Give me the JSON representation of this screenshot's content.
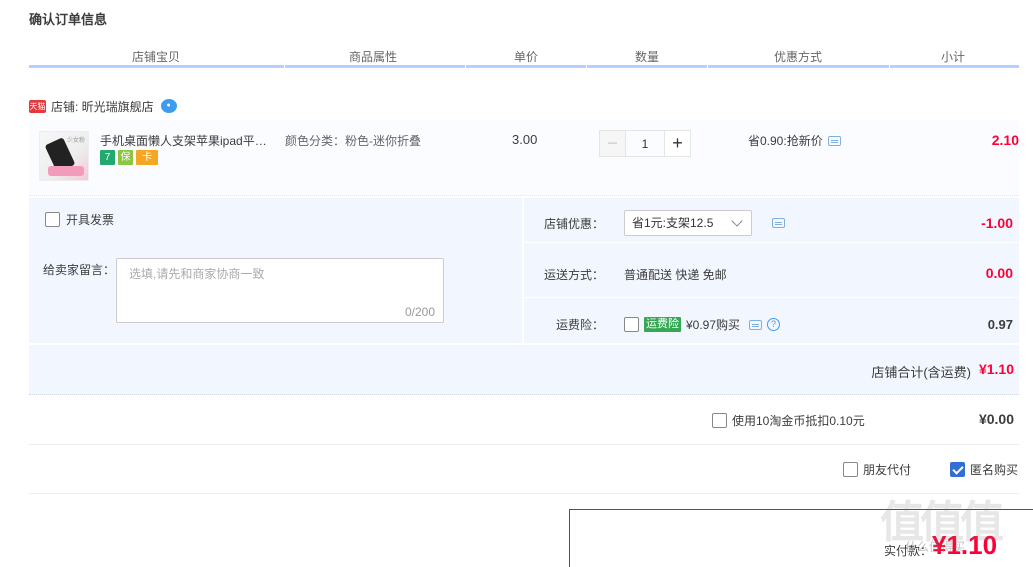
{
  "page_title": "确认订单信息",
  "columns": [
    "店铺宝贝",
    "商品属性",
    "单价",
    "数量",
    "优惠方式",
    "小计"
  ],
  "shop": {
    "tag": "天猫",
    "name": "店铺: 昕光瑞旗舰店"
  },
  "item": {
    "name": "手机桌面懒人支架苹果ipad平板电脑支架",
    "attr": "颜色分类：粉色-迷你折叠",
    "price": "3.00",
    "qty": "1",
    "minus": "−",
    "plus": "+",
    "promo": "省0.90:抢新价",
    "subtotal": "2.10",
    "badges": [
      "7",
      "保",
      "卡"
    ]
  },
  "invoice_label": "开具发票",
  "message": {
    "label": "给卖家留言：",
    "placeholder": "选填,请先和商家协商一致",
    "count": "0/200"
  },
  "shop_coupon": {
    "label": "店铺优惠：",
    "value": "省1元:支架12.5",
    "amount": "-1.00"
  },
  "shipping": {
    "label": "运送方式：",
    "value": "普通配送 快递 免邮",
    "amount": "0.00"
  },
  "insurance": {
    "label": "运费险：",
    "tag": "运费险",
    "text": "¥0.97购买",
    "amount": "0.97",
    "q": "?"
  },
  "shop_total": {
    "label": "店铺合计(含运费)",
    "value": "¥1.10"
  },
  "coins": {
    "label": "使用10淘金币抵扣0.10元",
    "value": "¥0.00"
  },
  "friend_pay_label": "朋友代付",
  "anonymous_label": "匿名购买",
  "pay": {
    "label": "实付款：",
    "value": "¥1.10"
  },
  "watermark": {
    "big": "值值值",
    "small": "什么值得买"
  },
  "colors": {
    "accent_red": "#ff0036",
    "header_line": "#b2d1ff",
    "panel_bg": "#f2f7ff",
    "tmall_red": "#e4393c"
  }
}
